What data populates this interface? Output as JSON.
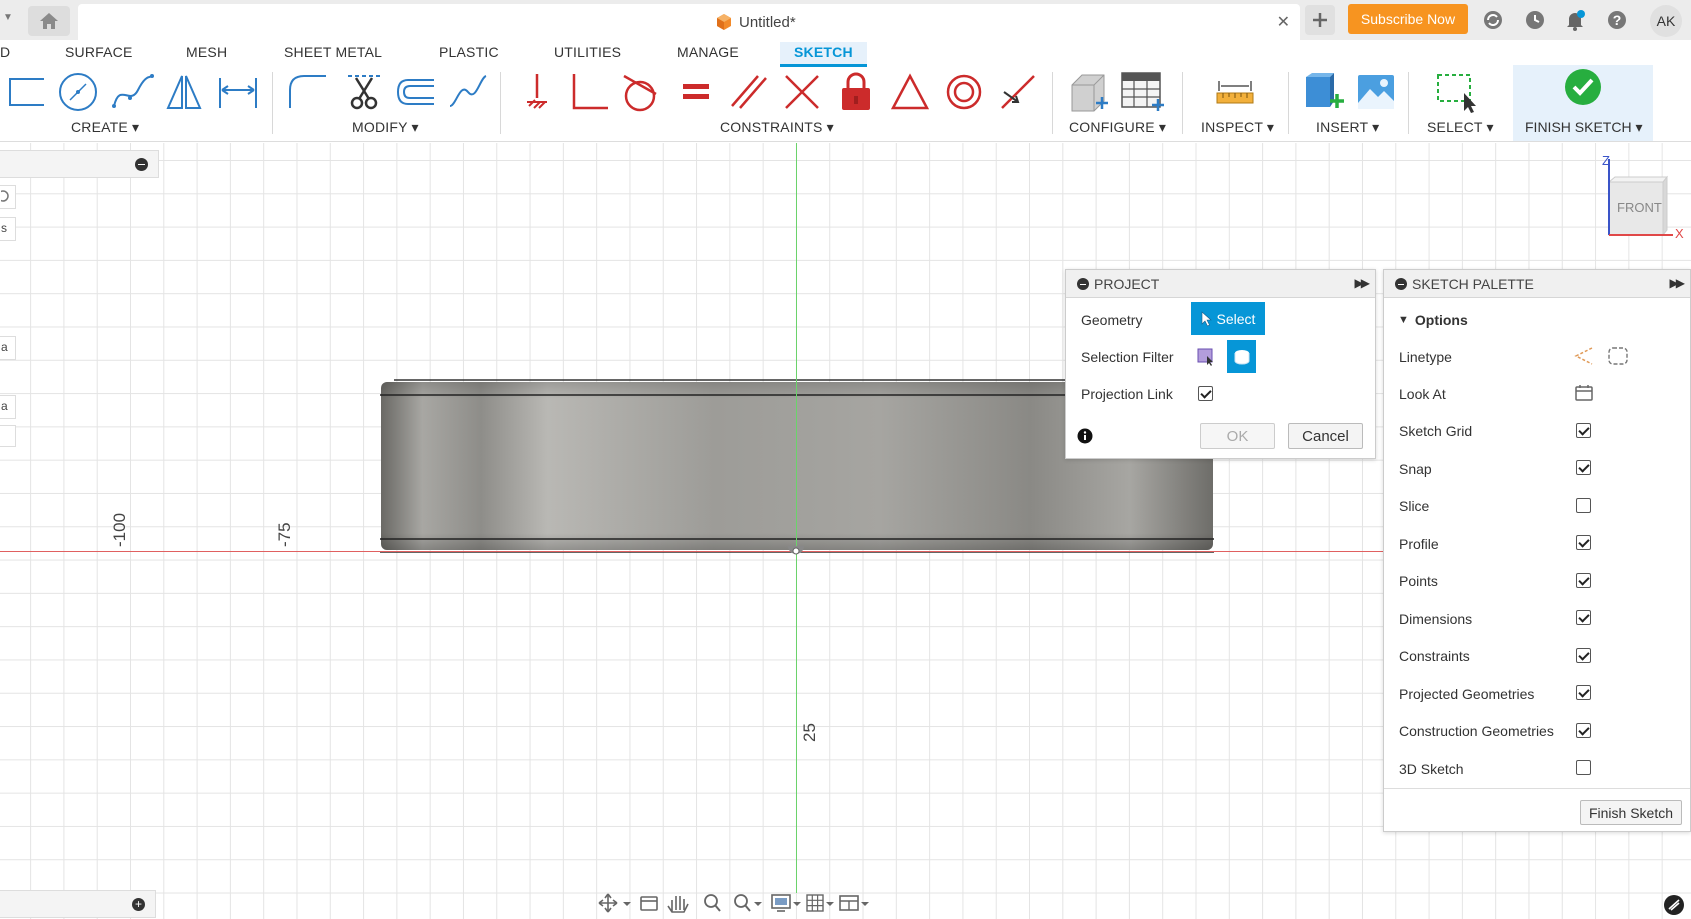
{
  "titlebar": {
    "document_title": "Untitled*",
    "subscribe_label": "Subscribe Now",
    "user_initials": "AK"
  },
  "ribbon": {
    "tabs": [
      "D",
      "SURFACE",
      "MESH",
      "SHEET METAL",
      "PLASTIC",
      "UTILITIES",
      "MANAGE",
      "SKETCH"
    ],
    "active_tab": "SKETCH",
    "groups": {
      "create": "CREATE",
      "modify": "MODIFY",
      "constraints": "CONSTRAINTS",
      "configure": "CONFIGURE",
      "inspect": "INSPECT",
      "insert": "INSERT",
      "select": "SELECT",
      "finish": "FINISH SKETCH"
    }
  },
  "canvas": {
    "ruler_labels": [
      "-100",
      "-75",
      "25"
    ],
    "side_fragments": [
      "s",
      "a",
      "a"
    ]
  },
  "viewcube": {
    "face": "FRONT",
    "axis_z": "Z",
    "axis_x": "X"
  },
  "project_dialog": {
    "title": "PROJECT",
    "geometry_label": "Geometry",
    "select_button": "Select",
    "selection_filter_label": "Selection Filter",
    "projection_link_label": "Projection Link",
    "projection_link_checked": true,
    "ok_label": "OK",
    "cancel_label": "Cancel"
  },
  "sketch_palette": {
    "title": "SKETCH PALETTE",
    "section": "Options",
    "rows": [
      {
        "label": "Linetype",
        "type": "icons"
      },
      {
        "label": "Look At",
        "type": "icon"
      },
      {
        "label": "Sketch Grid",
        "checked": true
      },
      {
        "label": "Snap",
        "checked": true
      },
      {
        "label": "Slice",
        "checked": false
      },
      {
        "label": "Profile",
        "checked": true
      },
      {
        "label": "Points",
        "checked": true
      },
      {
        "label": "Dimensions",
        "checked": true
      },
      {
        "label": "Constraints",
        "checked": true
      },
      {
        "label": "Projected Geometries",
        "checked": true
      },
      {
        "label": "Construction Geometries",
        "checked": true
      },
      {
        "label": "3D Sketch",
        "checked": false
      }
    ],
    "finish_button": "Finish Sketch"
  },
  "colors": {
    "accent": "#0696d7",
    "subscribe": "#f79420",
    "finish_check": "#27ae3f",
    "x_axis": "#e06060",
    "y_axis": "#6bd36b"
  }
}
